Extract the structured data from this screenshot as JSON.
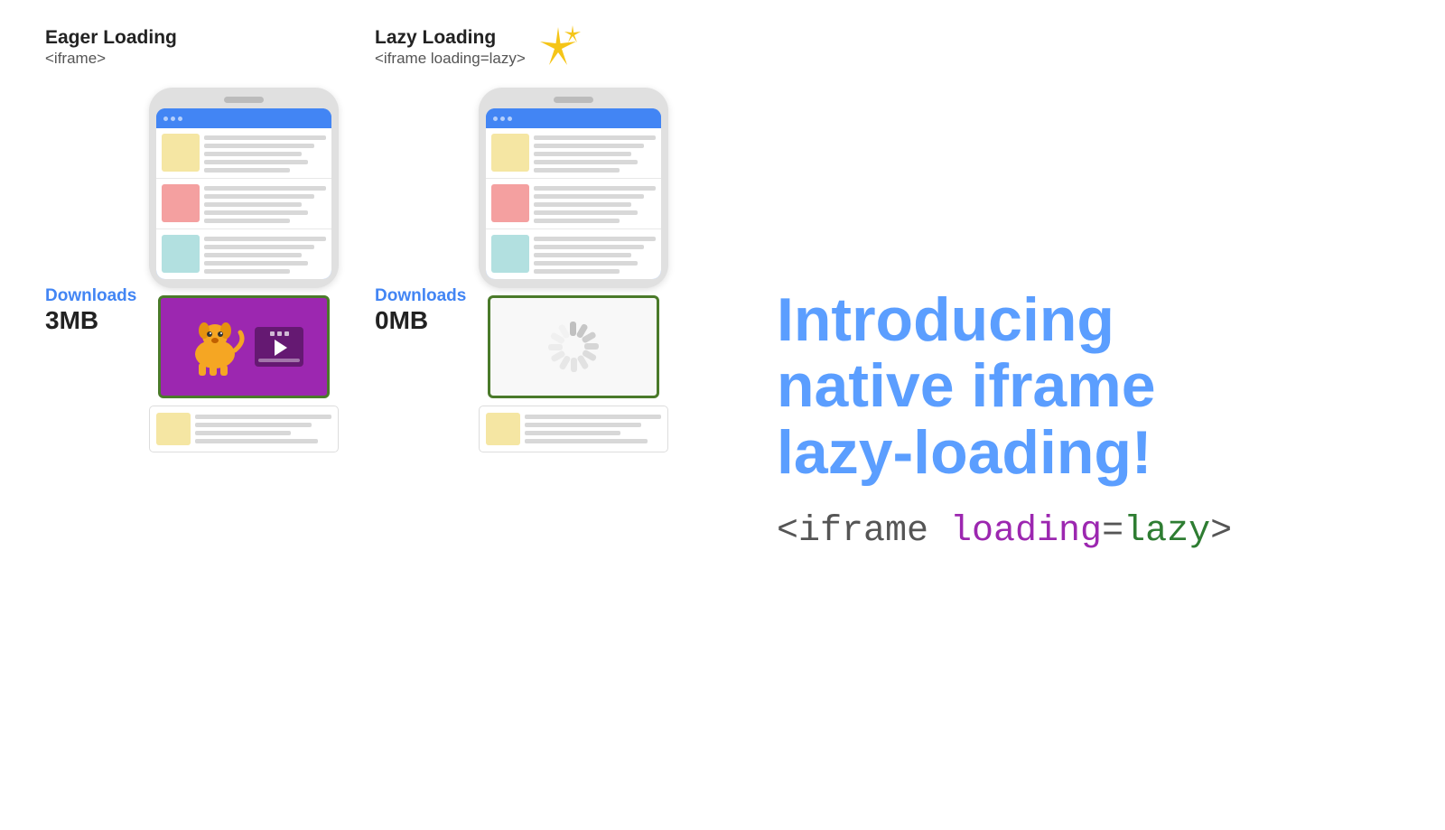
{
  "eager": {
    "title": "Eager Loading",
    "subtitle": "<iframe>",
    "downloads_label": "Downloads",
    "downloads_value": "3MB"
  },
  "lazy": {
    "title": "Lazy Loading",
    "subtitle": "<iframe loading=lazy>",
    "downloads_label": "Downloads",
    "downloads_value": "0MB"
  },
  "intro": {
    "line1": "Introducing",
    "line2": "native iframe",
    "line3": "lazy-loading!"
  },
  "code_tag": {
    "open": "<iframe ",
    "attr": "loading",
    "equals": "=",
    "value": "lazy",
    "close": ">"
  },
  "colors": {
    "blue": "#4285f4",
    "intro_blue": "#5b9eff",
    "purple": "#9c27b0",
    "green": "#2e7d32",
    "yellow": "#f5c518"
  }
}
